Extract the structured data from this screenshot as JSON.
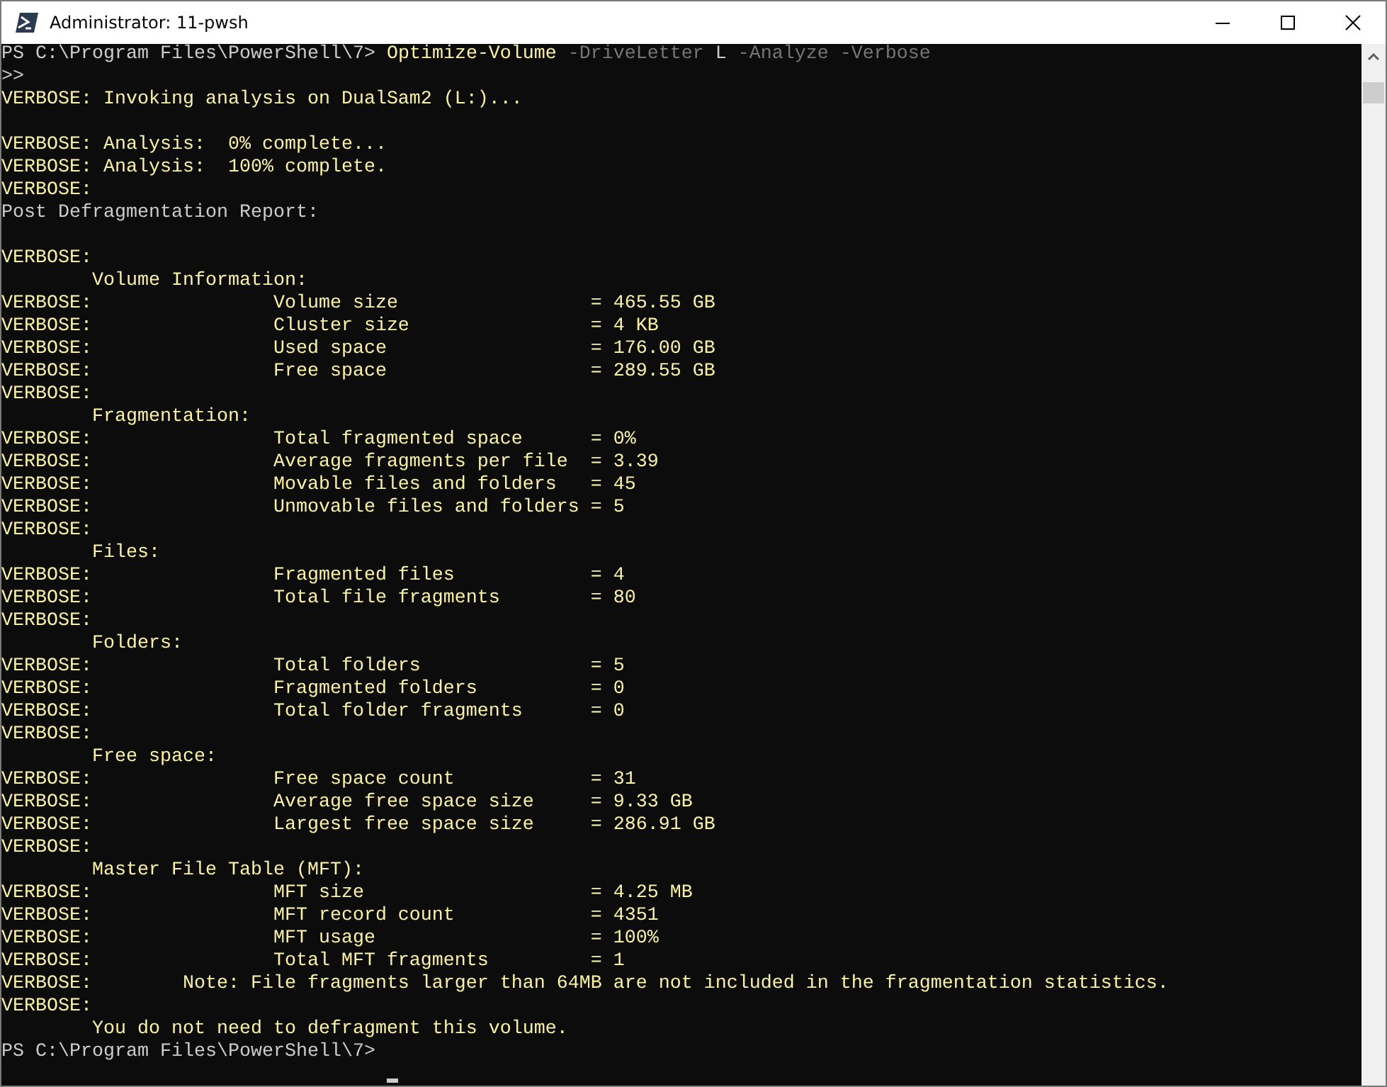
{
  "window": {
    "title": "Administrator: 11-pwsh"
  },
  "console": {
    "lines": [
      {
        "kind": "command",
        "tokens": [
          {
            "kind": "prompt",
            "text": "PS C:\\Program Files\\PowerShell\\7> "
          },
          {
            "kind": "cmdlet",
            "text": "Optimize-Volume"
          },
          {
            "kind": "param",
            "text": " -DriveLetter"
          },
          {
            "kind": "arg",
            "text": " L"
          },
          {
            "kind": "param",
            "text": " -Analyze -Verbose"
          }
        ]
      },
      {
        "kind": "output",
        "text": ">>"
      },
      {
        "kind": "verbose",
        "text": "VERBOSE: Invoking analysis on DualSam2 (L:)..."
      },
      {
        "kind": "blank"
      },
      {
        "kind": "verbose",
        "text": "VERBOSE: Analysis:  0% complete..."
      },
      {
        "kind": "verbose",
        "text": "VERBOSE: Analysis:  100% complete."
      },
      {
        "kind": "verbose",
        "text": "VERBOSE:"
      },
      {
        "kind": "output",
        "text": "Post Defragmentation Report:"
      },
      {
        "kind": "blank"
      },
      {
        "kind": "verbose",
        "text": "VERBOSE:"
      },
      {
        "kind": "verbose",
        "text": "        Volume Information:"
      },
      {
        "kind": "verbose",
        "text": "VERBOSE:                Volume size                 = 465.55 GB"
      },
      {
        "kind": "verbose",
        "text": "VERBOSE:                Cluster size                = 4 KB"
      },
      {
        "kind": "verbose",
        "text": "VERBOSE:                Used space                  = 176.00 GB"
      },
      {
        "kind": "verbose",
        "text": "VERBOSE:                Free space                  = 289.55 GB"
      },
      {
        "kind": "verbose",
        "text": "VERBOSE:"
      },
      {
        "kind": "verbose",
        "text": "        Fragmentation:"
      },
      {
        "kind": "verbose",
        "text": "VERBOSE:                Total fragmented space      = 0%"
      },
      {
        "kind": "verbose",
        "text": "VERBOSE:                Average fragments per file  = 3.39"
      },
      {
        "kind": "verbose",
        "text": "VERBOSE:                Movable files and folders   = 45"
      },
      {
        "kind": "verbose",
        "text": "VERBOSE:                Unmovable files and folders = 5"
      },
      {
        "kind": "verbose",
        "text": "VERBOSE:"
      },
      {
        "kind": "verbose",
        "text": "        Files:"
      },
      {
        "kind": "verbose",
        "text": "VERBOSE:                Fragmented files            = 4"
      },
      {
        "kind": "verbose",
        "text": "VERBOSE:                Total file fragments        = 80"
      },
      {
        "kind": "verbose",
        "text": "VERBOSE:"
      },
      {
        "kind": "verbose",
        "text": "        Folders:"
      },
      {
        "kind": "verbose",
        "text": "VERBOSE:                Total folders               = 5"
      },
      {
        "kind": "verbose",
        "text": "VERBOSE:                Fragmented folders          = 0"
      },
      {
        "kind": "verbose",
        "text": "VERBOSE:                Total folder fragments      = 0"
      },
      {
        "kind": "verbose",
        "text": "VERBOSE:"
      },
      {
        "kind": "verbose",
        "text": "        Free space:"
      },
      {
        "kind": "verbose",
        "text": "VERBOSE:                Free space count            = 31"
      },
      {
        "kind": "verbose",
        "text": "VERBOSE:                Average free space size     = 9.33 GB"
      },
      {
        "kind": "verbose",
        "text": "VERBOSE:                Largest free space size     = 286.91 GB"
      },
      {
        "kind": "verbose",
        "text": "VERBOSE:"
      },
      {
        "kind": "verbose",
        "text": "        Master File Table (MFT):"
      },
      {
        "kind": "verbose",
        "text": "VERBOSE:                MFT size                    = 4.25 MB"
      },
      {
        "kind": "verbose",
        "text": "VERBOSE:                MFT record count            = 4351"
      },
      {
        "kind": "verbose",
        "text": "VERBOSE:                MFT usage                   = 100%"
      },
      {
        "kind": "verbose",
        "text": "VERBOSE:                Total MFT fragments         = 1"
      },
      {
        "kind": "verbose",
        "text": "VERBOSE:        Note: File fragments larger than 64MB are not included in the fragmentation statistics."
      },
      {
        "kind": "verbose",
        "text": "VERBOSE:"
      },
      {
        "kind": "verbose",
        "text": "        You do not need to defragment this volume."
      },
      {
        "kind": "output",
        "text": "PS C:\\Program Files\\PowerShell\\7>"
      }
    ]
  }
}
